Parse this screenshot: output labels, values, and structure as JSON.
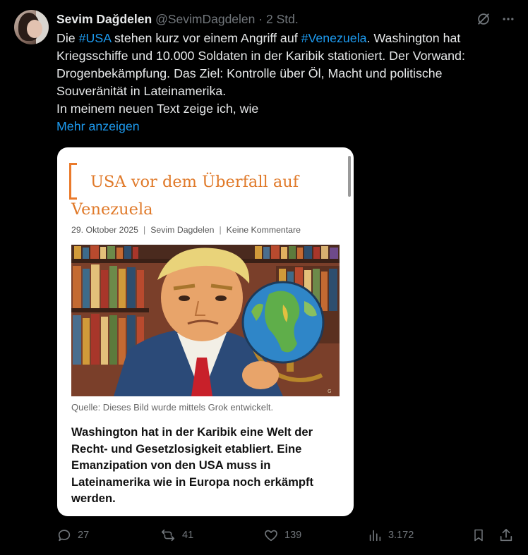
{
  "author": {
    "name": "Sevim Dağdelen",
    "handle": "@SevimDagdelen",
    "separator": "·",
    "time": "2 Std."
  },
  "icons": {
    "grok": "grok-icon",
    "more": "more-icon"
  },
  "post": {
    "text": {
      "p1": "Die ",
      "tag1": "#USA",
      "p2": " stehen kurz vor einem Angriff auf ",
      "tag2": "#Venezuela",
      "p3": ". Washington hat Kriegsschiffe und 10.000 Soldaten in der Karibik stationiert. Der Vorwand: Drogenbekämpfung. Das Ziel: Kontrolle über Öl, Macht und politische Souveränität in Lateinamerika.",
      "p4": "In meinem neuen Text zeige ich, wie"
    },
    "show_more": "Mehr anzeigen",
    "link_color": "#1d9bf0"
  },
  "card": {
    "title": "USA vor dem Überfall auf Venezuela",
    "date": "29. Oktober 2025",
    "author": "Sevim Dagdelen",
    "comments": "Keine Kommentare",
    "meta_sep": "|",
    "caption": "Quelle: Dieses Bild wurde mittels Grok entwickelt.",
    "lead": "Washington hat in der Karibik eine Welt der Recht- und Gesetzlosigkeit etabliert. Eine Emanzipation von den USA muss in Lateinamerika wie in Europa noch erkämpft werden.",
    "accent_color": "#e07a2a"
  },
  "actions": {
    "replies": "27",
    "reposts": "41",
    "likes": "139",
    "views": "3.172"
  }
}
